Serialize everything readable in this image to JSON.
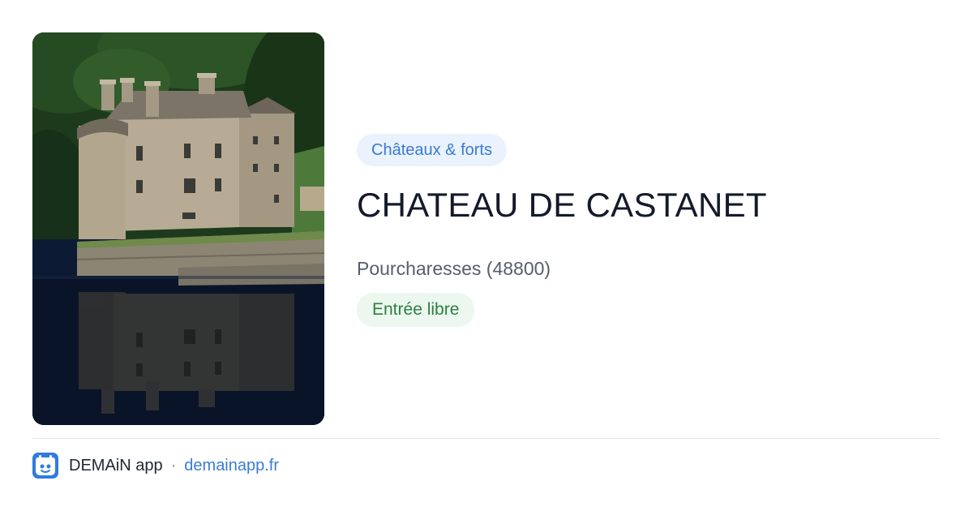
{
  "photo": {
    "alt": "Château de Castanet au bord du lac"
  },
  "category": {
    "label": "Châteaux & forts"
  },
  "place": {
    "title": "CHATEAU DE CASTANET",
    "location": "Pourcharesses (48800)",
    "status": "Entrée libre"
  },
  "footer": {
    "app_name": "DEMAiN app",
    "separator": "·",
    "site": "demainapp.fr"
  },
  "colors": {
    "accent": "#3a7bd5",
    "category_bg": "#eaf2fd",
    "status_text": "#2b7f3f",
    "status_bg": "#ecf8ef",
    "title": "#141a2a"
  },
  "icons": {
    "app_logo": "demain-app-logo-icon"
  }
}
